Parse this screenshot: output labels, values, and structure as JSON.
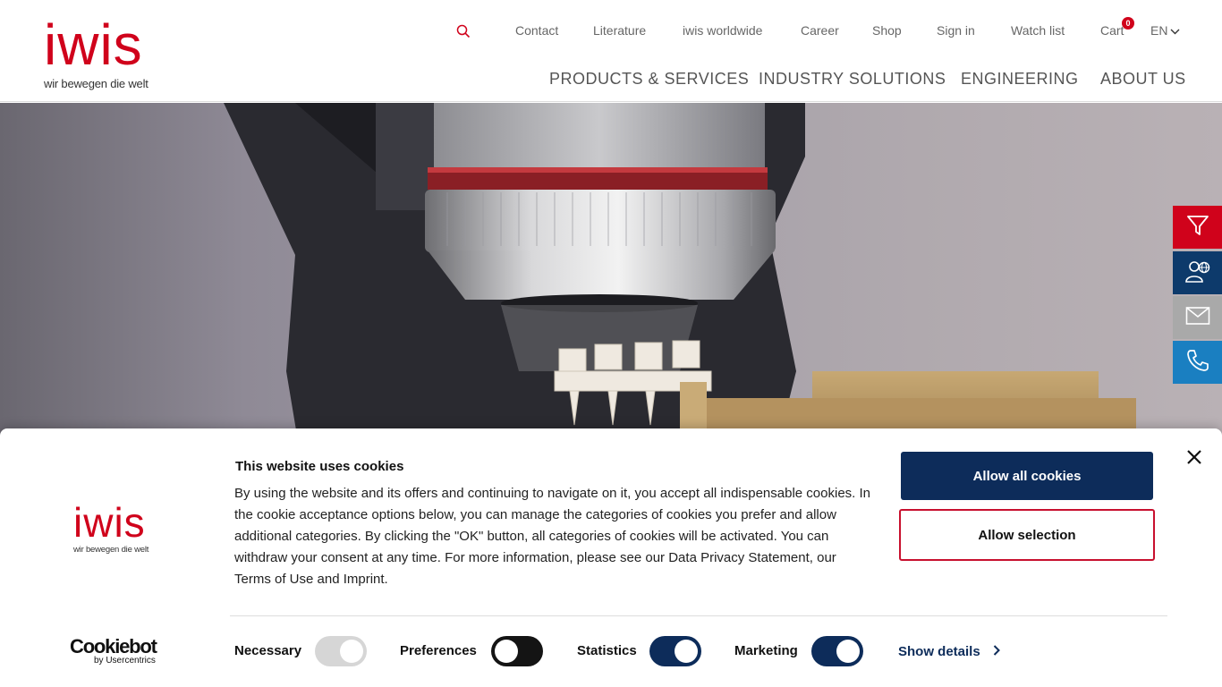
{
  "brand": {
    "name": "iwis",
    "tagline": "wir bewegen die welt",
    "color": "#d0021b"
  },
  "header": {
    "top_links": [
      "Contact",
      "Literature",
      "iwis worldwide",
      "Career",
      "Shop",
      "Sign in",
      "Watch list",
      "Cart"
    ],
    "cart_count": "0",
    "language": "EN",
    "main_nav": [
      "PRODUCTS & SERVICES",
      "INDUSTRY SOLUTIONS",
      "ENGINEERING",
      "ABOUT US"
    ]
  },
  "side_actions": [
    {
      "icon": "filter-icon",
      "color": "#d0021b"
    },
    {
      "icon": "person-globe-icon",
      "color": "#0d3a6b"
    },
    {
      "icon": "envelope-icon",
      "color": "#a9a9a9"
    },
    {
      "icon": "phone-icon",
      "color": "#1a7fc1"
    }
  ],
  "cookie": {
    "title": "This website uses cookies",
    "body": "By using the website and its offers and continuing to navigate on it, you accept all indispensable cookies. In the cookie acceptance options below, you can manage the categories of cookies you prefer and allow additional categories. By clicking the \"OK\" button, all categories of cookies will be activated. You can withdraw your consent at any time. For more information, please see our Data Privacy Statement, our Terms of Use and Imprint.",
    "allow_all": "Allow all cookies",
    "allow_selection": "Allow selection",
    "categories": [
      {
        "label": "Necessary",
        "state": "disabled-on"
      },
      {
        "label": "Preferences",
        "state": "off"
      },
      {
        "label": "Statistics",
        "state": "on"
      },
      {
        "label": "Marketing",
        "state": "on"
      }
    ],
    "show_details": "Show details",
    "provider": {
      "name": "Cookiebot",
      "sub": "by Usercentrics"
    }
  }
}
